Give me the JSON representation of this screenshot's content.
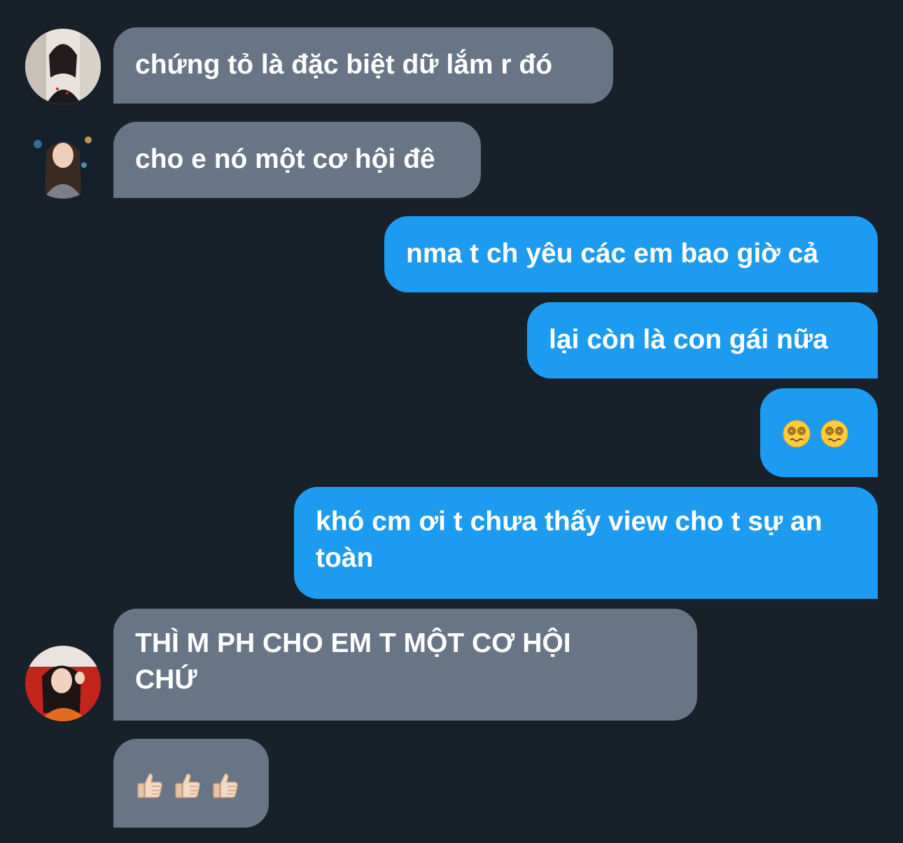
{
  "colors": {
    "background": "#18202a",
    "incoming_bubble": "#677586",
    "outgoing_bubble": "#1d9bf0",
    "text": "#ffffff"
  },
  "messages": [
    {
      "direction": "incoming",
      "avatar": "avatar-1",
      "text": "chứng tỏ là đặc biệt dữ lắm r đó"
    },
    {
      "direction": "incoming",
      "avatar": "avatar-2",
      "text": "cho e nó một cơ hội đê"
    },
    {
      "direction": "outgoing",
      "text": "nma t ch yêu các em bao giờ cả"
    },
    {
      "direction": "outgoing",
      "text": "lại còn là con gái nữa"
    },
    {
      "direction": "outgoing",
      "text": "😵‍💫 😵‍💫",
      "emoji_names": [
        "face-with-spiral-eyes",
        "face-with-spiral-eyes"
      ]
    },
    {
      "direction": "outgoing",
      "text": "khó cm ơi t chưa thấy view cho t sự an toàn"
    },
    {
      "direction": "incoming",
      "avatar": "avatar-3",
      "text": "THÌ M PH CHO EM T MỘT CƠ HỘI CHỨ"
    },
    {
      "direction": "incoming",
      "text": "👍🏻 👍🏻 👍🏻",
      "emoji_names": [
        "thumbs-up-light-skin",
        "thumbs-up-light-skin",
        "thumbs-up-light-skin"
      ]
    }
  ]
}
